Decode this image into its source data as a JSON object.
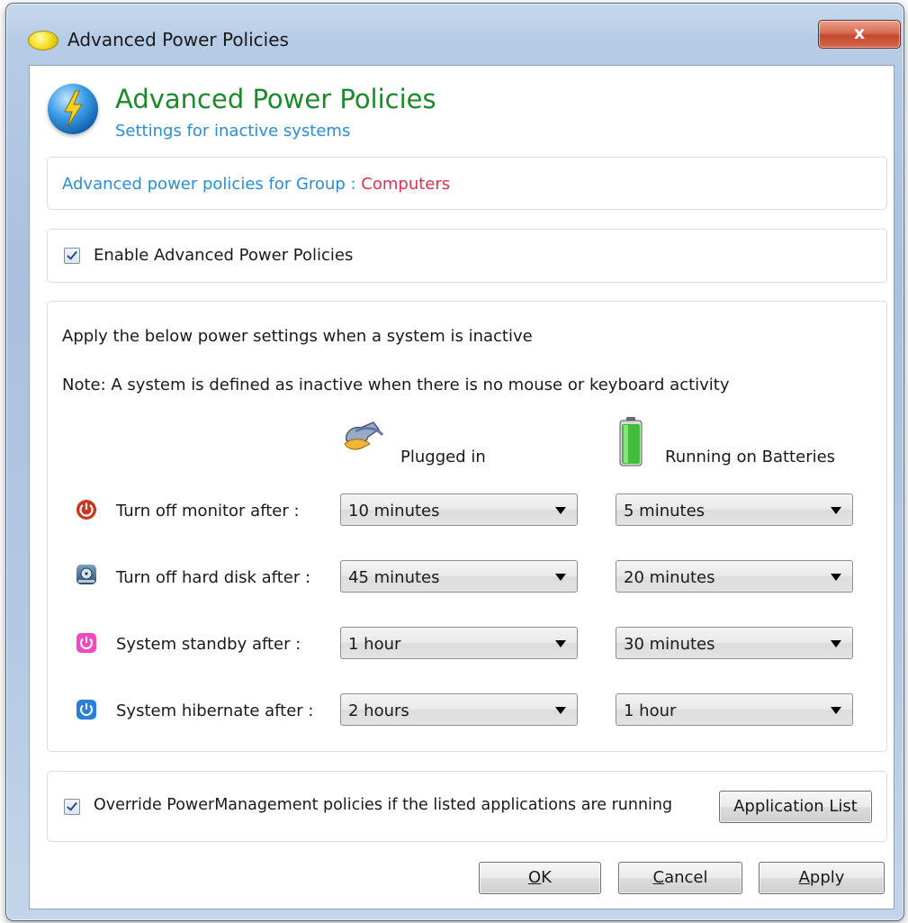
{
  "window": {
    "title": "Advanced Power Policies",
    "close_label": "x"
  },
  "header": {
    "title": "Advanced Power Policies",
    "subtitle": "Settings for inactive systems"
  },
  "group_info": {
    "label": "Advanced power policies for Group :",
    "value": "Computers"
  },
  "enable": {
    "checked": true,
    "label": "Enable Advanced Power Policies"
  },
  "settings": {
    "intro": "Apply the below power settings when a system is inactive",
    "note": "Note: A system is defined as inactive when there is no mouse or keyboard activity",
    "col_plugged": "Plugged in",
    "col_battery": "Running on Batteries",
    "rows": [
      {
        "icon": "power-red-icon",
        "label": "Turn off monitor after   :",
        "plugged": "10 minutes",
        "battery": "5 minutes"
      },
      {
        "icon": "hard-disk-icon",
        "label": "Turn off hard disk after :",
        "plugged": "45 minutes",
        "battery": "20 minutes"
      },
      {
        "icon": "standby-pink-icon",
        "label": "System standby after   :",
        "plugged": "1 hour",
        "battery": "30 minutes"
      },
      {
        "icon": "hibernate-blue-icon",
        "label": "System hibernate after :",
        "plugged": "2 hours",
        "battery": "1 hour"
      }
    ]
  },
  "override": {
    "checked": true,
    "label": "Override PowerManagement policies if the listed applications are running",
    "button": "Application List"
  },
  "buttons": {
    "ok_mnemonic": "O",
    "ok_rest": "K",
    "cancel_mnemonic": "C",
    "cancel_rest": "ancel",
    "apply_mnemonic": "A",
    "apply_rest": "pply"
  },
  "colors": {
    "header_title": "#1a8a2a",
    "accent_blue": "#2b8ed6",
    "group_value": "#e0304e"
  }
}
